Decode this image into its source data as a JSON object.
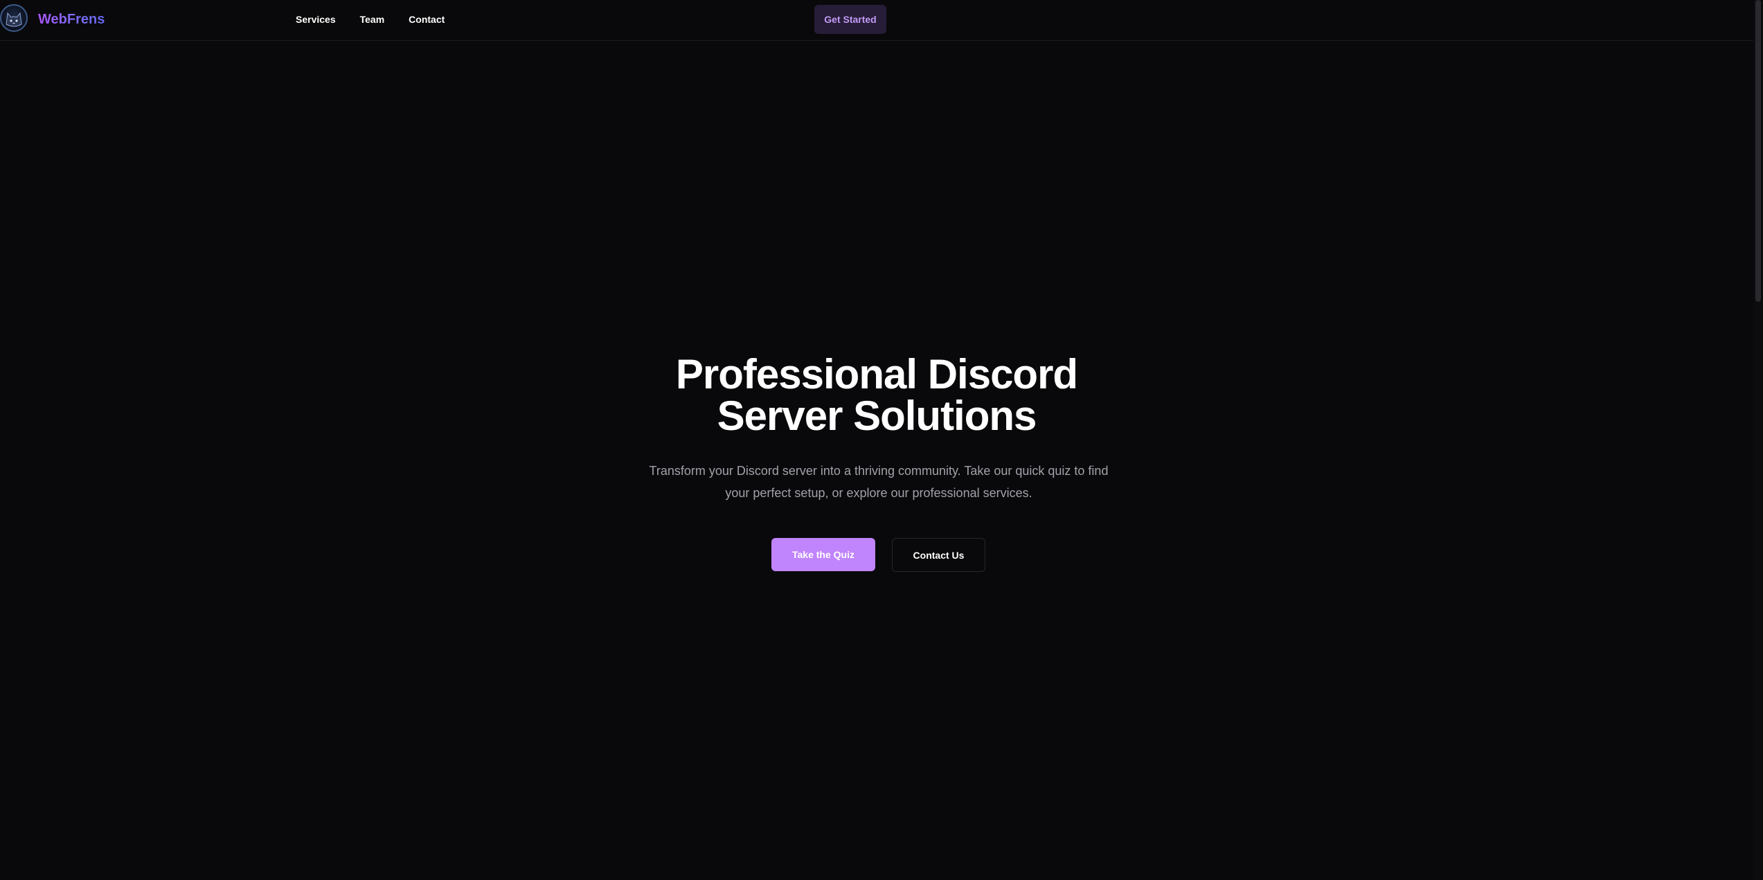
{
  "navbar": {
    "logo_icon": "cat-head-logo-icon",
    "brand": "WebFrens",
    "links": [
      "Services",
      "Team",
      "Contact"
    ],
    "cta_label": "Get Started"
  },
  "hero": {
    "title_line1": "Professional Discord",
    "title_line2": "Server Solutions",
    "subtitle": "Transform your Discord server into a thriving community. Take our quick quiz to find your perfect setup, or explore our professional services.",
    "primary_button": "Take the Quiz",
    "secondary_button": "Contact Us"
  },
  "colors": {
    "background": "#09090b",
    "accent": "#c084fc",
    "brand_gradient_start": "#a855f7",
    "brand_gradient_end": "#6366f1",
    "cta_bg": "#271d38",
    "cta_text": "#c39bf7",
    "muted_text": "#a1a1aa"
  }
}
